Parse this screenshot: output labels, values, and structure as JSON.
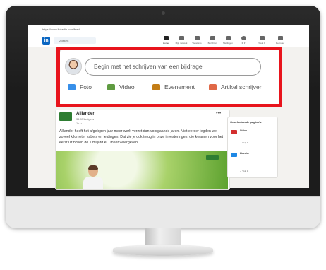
{
  "browser": {
    "url": "https://www.linkedin.com/feed/"
  },
  "nav": {
    "logo": "in",
    "search_placeholder": "Zoeken",
    "items": [
      {
        "label": "Home",
        "icon": "home-icon"
      },
      {
        "label": "Mijn netwerk",
        "icon": "network-icon"
      },
      {
        "label": "Vacatures",
        "icon": "jobs-icon"
      },
      {
        "label": "Berichten",
        "icon": "messages-icon"
      },
      {
        "label": "Meldingen",
        "icon": "notifications-icon"
      },
      {
        "label": "Ik ▾",
        "icon": "profile-icon"
      },
      {
        "label": "Werk ▾",
        "icon": "grid-icon"
      },
      {
        "label": "Recruiter",
        "icon": "recruiter-icon"
      }
    ]
  },
  "share_box": {
    "placeholder": "Begin met het schrijven van een bijdrage",
    "actions": [
      {
        "label": "Foto",
        "icon": "photo-icon",
        "color": "#378fe9"
      },
      {
        "label": "Video",
        "icon": "video-icon",
        "color": "#5f9b41"
      },
      {
        "label": "Evenement",
        "icon": "calendar-icon",
        "color": "#c37d16"
      },
      {
        "label": "Artikel schrijven",
        "icon": "article-icon",
        "color": "#e06847"
      }
    ],
    "highlight_color": "#e8141c"
  },
  "post": {
    "company": "Alliander",
    "followers": "34.831volgers",
    "time": "1 u •",
    "more_icon": "•••",
    "text": "Alliander heeft het afgelopen jaar meer werk verzet dan voorgaande jaren. Niet eerder legden we zoveel kilometer kabels en leidingen. Dat zie je ook terug in onze investeringen: die kwamen voor het eerst uit boven de 1 miljard e ...meer weergeven"
  },
  "sidebar": {
    "title": "Geselecteerde pagina's",
    "pages": [
      {
        "name": "Strive",
        "follow": "✓ Volg ik"
      },
      {
        "name": "Liander",
        "follow": "✓ Volg ik"
      }
    ]
  }
}
